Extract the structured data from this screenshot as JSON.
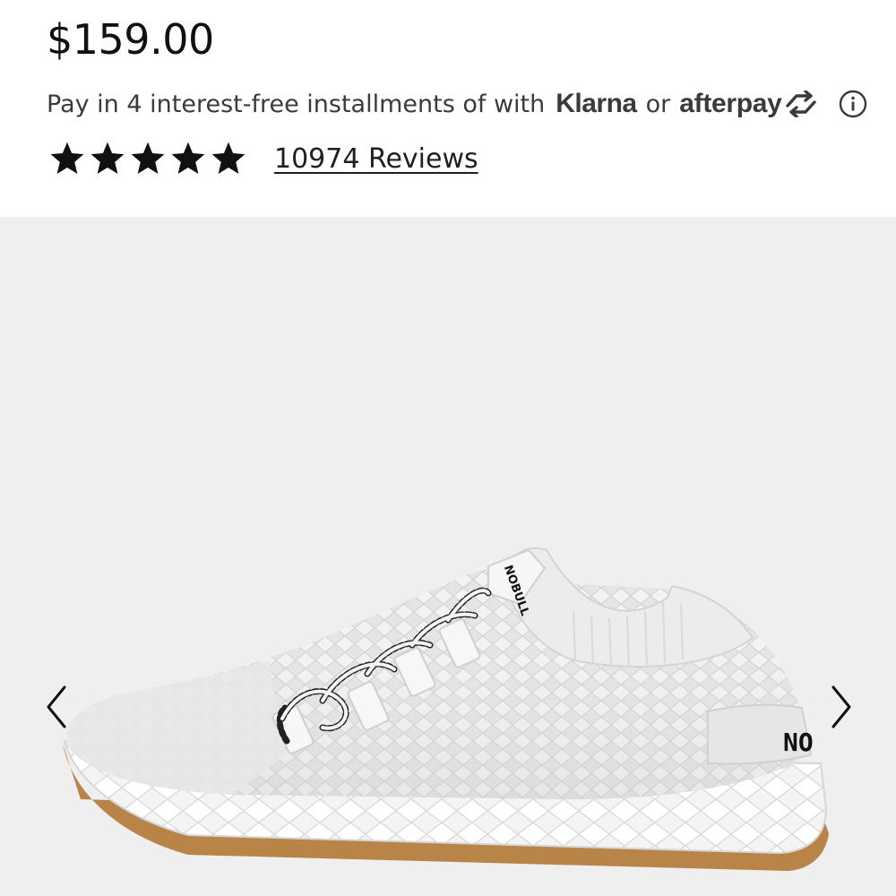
{
  "product": {
    "price": "$159.00",
    "installments": {
      "text": "Pay in 4 interest-free installments of with",
      "klarna": "Klarna",
      "separator": "or",
      "afterpay": "afterpay"
    },
    "rating": {
      "stars": 5,
      "reviews_label": "10974 Reviews"
    }
  },
  "gallery": {
    "background": "#efefef",
    "brand_mark": "NO",
    "tongue_mark": "NOBULL",
    "icons": {
      "prev": "chevron-left-icon",
      "next": "chevron-right-icon",
      "info": "info-icon",
      "star": "star-icon"
    }
  }
}
